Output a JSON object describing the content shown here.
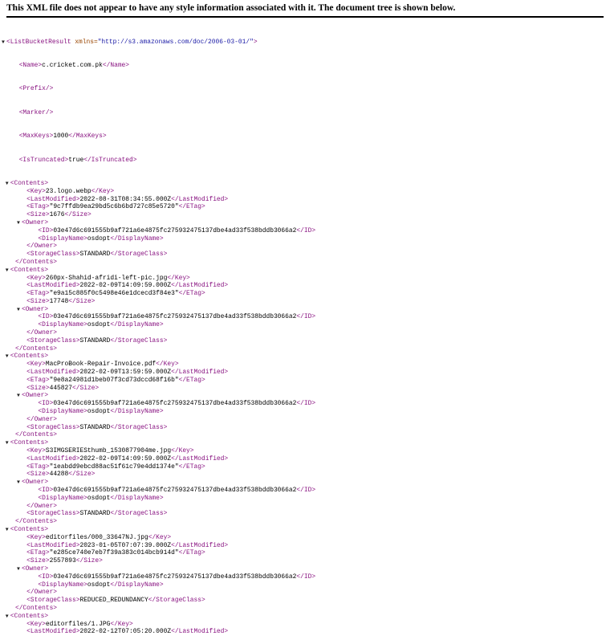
{
  "banner": {
    "message": "This XML file does not appear to have any style information associated with it. The document tree is shown below."
  },
  "root": {
    "open": "<ListBucketResult",
    "attr_name": "xmlns",
    "attr_value": "\"http://s3.amazonaws.com/doc/2006-03-01/\"",
    "open_end": ">",
    "name_open": "<Name>",
    "name_value": "c.cricket.com.pk",
    "name_close": "</Name>",
    "prefix": "<Prefix/>",
    "marker": "<Marker/>",
    "maxkeys_open": "<MaxKeys>",
    "maxkeys_value": "1000",
    "maxkeys_close": "</MaxKeys>",
    "truncated_open": "<IsTruncated>",
    "truncated_value": "true",
    "truncated_close": "</IsTruncated>"
  },
  "tags": {
    "contents_open": "<Contents>",
    "contents_close": "</Contents>",
    "key_open": "<Key>",
    "key_close": "</Key>",
    "lastmod_open": "<LastModified>",
    "lastmod_close": "</LastModified>",
    "etag_open": "<ETag>",
    "etag_close": "</ETag>",
    "size_open": "<Size>",
    "size_close": "</Size>",
    "owner_open": "<Owner>",
    "owner_close": "</Owner>",
    "id_open": "<ID>",
    "id_close": "</ID>",
    "display_open": "<DisplayName>",
    "display_close": "</DisplayName>",
    "storage_open": "<StorageClass>",
    "storage_close": "</StorageClass>"
  },
  "toggle_glyph": "▼",
  "contents": [
    {
      "key": "23.logo.webp",
      "last_modified": "2022-08-31T08:34:55.000Z",
      "etag": "\"9c7ffdb9ea29bd5c6b6bd727c85e5720\"",
      "size": "1676",
      "owner_id": "03e47d6c691555b9af721a6e4875fc275932475137dbe4ad33f538bddb3066a2",
      "display_name": "osdopt",
      "storage_class": "STANDARD"
    },
    {
      "key": "260px-Shahid-afridi-left-pic.jpg",
      "last_modified": "2022-02-09T14:09:59.000Z",
      "etag": "\"e9a15c885f0c5498e46e1dcecd3f84e3\"",
      "size": "17748",
      "owner_id": "03e47d6c691555b9af721a6e4875fc275932475137dbe4ad33f538bddb3066a2",
      "display_name": "osdopt",
      "storage_class": "STANDARD"
    },
    {
      "key": "MacProBook-Repair-Invoice.pdf",
      "last_modified": "2022-02-09T13:59:59.000Z",
      "etag": "\"9e8a24981d1beb07f3cd73dccd68f16b\"",
      "size": "445827",
      "owner_id": "03e47d6c691555b9af721a6e4875fc275932475137dbe4ad33f538bddb3066a2",
      "display_name": "osdopt",
      "storage_class": "STANDARD"
    },
    {
      "key": "S3IMGSERIESthumb_1530877904me.jpg",
      "last_modified": "2022-02-09T14:09:59.000Z",
      "etag": "\"1eabdd9ebcd88ac51f61c79e4dd1374e\"",
      "size": "44288",
      "owner_id": "03e47d6c691555b9af721a6e4875fc275932475137dbe4ad33f538bddb3066a2",
      "display_name": "osdopt",
      "storage_class": "STANDARD"
    },
    {
      "key": "editorfiles/000_33647NJ.jpg",
      "last_modified": "2023-01-05T07:07:39.000Z",
      "etag": "\"e285ce740e7eb7f39a383c014bcb914d\"",
      "size": "2557893",
      "owner_id": "03e47d6c691555b9af721a6e4875fc275932475137dbe4ad33f538bddb3066a2",
      "display_name": "osdopt",
      "storage_class": "REDUCED_REDUNDANCY"
    },
    {
      "key": "editorfiles/1.JPG",
      "last_modified": "2022-02-12T07:05:20.000Z"
    }
  ]
}
